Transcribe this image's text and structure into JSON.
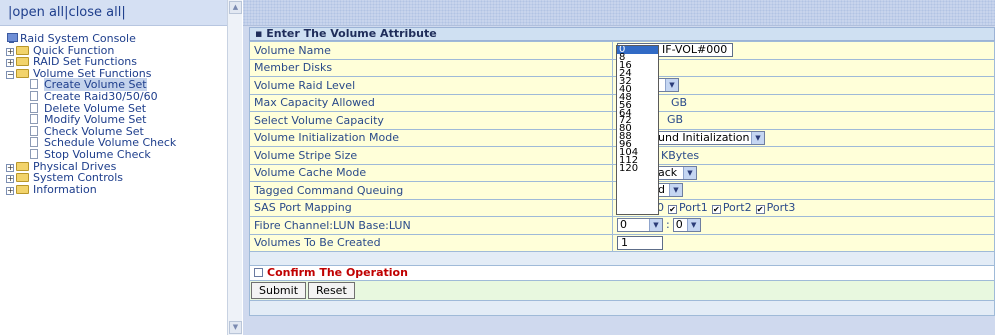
{
  "nav_top": {
    "open_all": "open all",
    "sep": "|",
    "close_all": "close all"
  },
  "tree": {
    "root": "Raid System Console",
    "quick_function": "Quick Function",
    "raid_set_functions": "RAID Set Functions",
    "volume_set_functions": "Volume Set Functions",
    "volume_children": [
      "Create Volume Set",
      "Create Raid30/50/60",
      "Delete Volume Set",
      "Modify Volume Set",
      "Check Volume Set",
      "Schedule Volume Check",
      "Stop Volume Check"
    ],
    "physical_drives": "Physical Drives",
    "system_controls": "System Controls",
    "information": "Information"
  },
  "form": {
    "header": "Enter The Volume Attribute",
    "volume_name_label": "Volume Name",
    "volume_name_value": "IF-VOL#000",
    "member_disks_label": "Member Disks",
    "raid_level_label": "Volume Raid Level",
    "max_capacity_label": "Max Capacity Allowed",
    "max_capacity_unit": "GB",
    "select_capacity_label": "Select Volume Capacity",
    "select_capacity_unit": "GB",
    "init_mode_label": "Volume Initialization Mode",
    "init_mode_value": "und Initialization",
    "stripe_size_label": "Volume Stripe Size",
    "stripe_size_unit": "KBytes",
    "cache_mode_label": "Volume Cache Mode",
    "cache_mode_value": "ack",
    "tcq_label": "Tagged Command Queuing",
    "tcq_value": "d",
    "sas_mapping_label": "SAS Port Mapping",
    "sas_port0_partial": "0",
    "sas_port1": "Port1",
    "sas_port2": "Port2",
    "sas_port3": "Port3",
    "fibre_label": "Fibre Channel:LUN Base:LUN",
    "fibre_base_value": "0",
    "fibre_sep": ":",
    "fibre_lun_value": "0",
    "volumes_created_label": "Volumes To Be Created",
    "volumes_created_value": "1"
  },
  "confirm_label": "Confirm The Operation",
  "buttons": {
    "submit": "Submit",
    "reset": "Reset"
  },
  "dropdown_options": [
    "0",
    "8",
    "16",
    "24",
    "32",
    "40",
    "48",
    "56",
    "64",
    "72",
    "80",
    "88",
    "96",
    "104",
    "112",
    "120"
  ],
  "dropdown_selected": "0",
  "check_mark": "✔",
  "colors": {
    "confirm_text": "#c00000",
    "selected_option": "#316ac5",
    "form_background": "#ffffd9"
  }
}
